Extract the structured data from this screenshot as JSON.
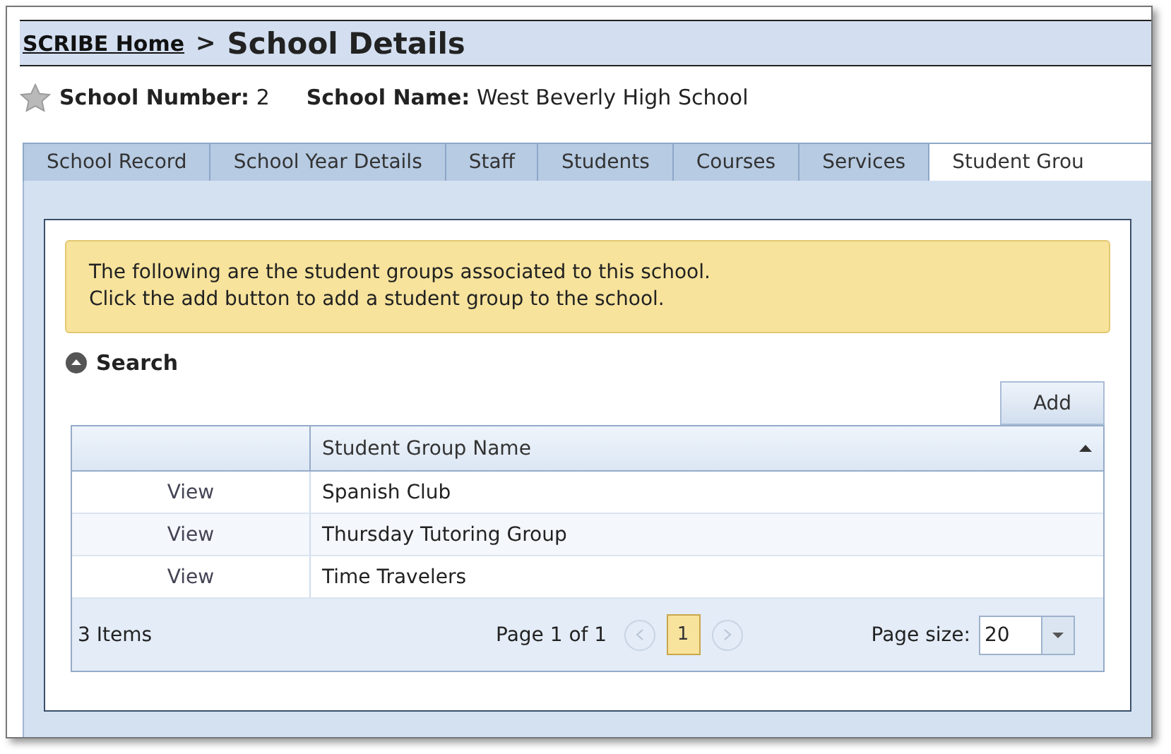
{
  "breadcrumb": {
    "home_link": "SCRIBE Home",
    "separator": ">",
    "title": "School Details"
  },
  "school_info": {
    "favorite": false,
    "number_label": "School Number:",
    "number": "2",
    "name_label": "School Name:",
    "name": "West Beverly High School"
  },
  "tabs": [
    {
      "label": "School Record",
      "selected": false
    },
    {
      "label": "School Year Details",
      "selected": false
    },
    {
      "label": "Staff",
      "selected": false
    },
    {
      "label": "Students",
      "selected": false
    },
    {
      "label": "Courses",
      "selected": false
    },
    {
      "label": "Services",
      "selected": false
    },
    {
      "label": "Student Grou",
      "selected": true
    }
  ],
  "notice": [
    "The following are the student groups associated to this school.",
    "Click the add button to add a student group to the school."
  ],
  "search": {
    "label": "Search",
    "expanded": false
  },
  "add_button": "Add",
  "table": {
    "columns": [
      "",
      "Student Group Name"
    ],
    "sort_ascending": true,
    "rows": [
      {
        "action": "View",
        "name": "Spanish Club"
      },
      {
        "action": "View",
        "name": "Thursday Tutoring Group"
      },
      {
        "action": "View",
        "name": "Time Travelers"
      }
    ]
  },
  "pager": {
    "items": "3 Items",
    "page_info": "Page 1 of 1",
    "pages": [
      {
        "label": "1",
        "selected": true
      }
    ],
    "page_size_label": "Page size:",
    "page_size": "20"
  }
}
